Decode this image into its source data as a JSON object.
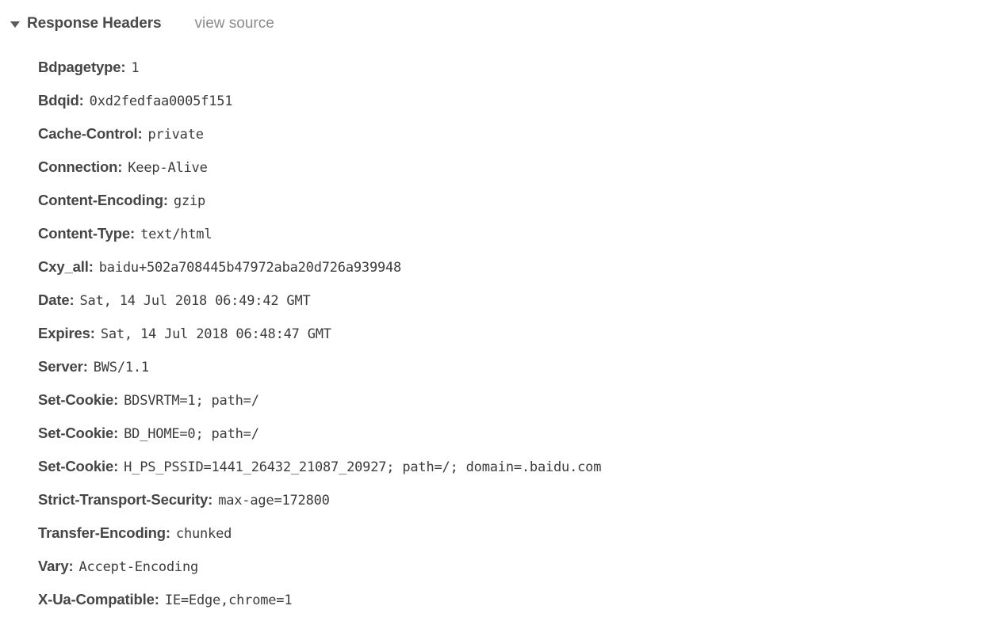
{
  "panel": {
    "title": "Response Headers",
    "view_source_label": "view source",
    "expanded": true,
    "disclosure_icon": "triangle-down-icon",
    "colors": {
      "background": "#ffffff",
      "header_name": "#454545",
      "header_value": "#3c3c3c",
      "section_title": "#4a4a4a",
      "link": "#8c8c8c"
    }
  },
  "headers": [
    {
      "name": "Bdpagetype:",
      "value": "1"
    },
    {
      "name": "Bdqid:",
      "value": "0xd2fedfaa0005f151"
    },
    {
      "name": "Cache-Control:",
      "value": "private"
    },
    {
      "name": "Connection:",
      "value": "Keep-Alive"
    },
    {
      "name": "Content-Encoding:",
      "value": "gzip"
    },
    {
      "name": "Content-Type:",
      "value": "text/html"
    },
    {
      "name": "Cxy_all:",
      "value": "baidu+502a708445b47972aba20d726a939948"
    },
    {
      "name": "Date:",
      "value": "Sat, 14 Jul 2018 06:49:42 GMT"
    },
    {
      "name": "Expires:",
      "value": "Sat, 14 Jul 2018 06:48:47 GMT"
    },
    {
      "name": "Server:",
      "value": "BWS/1.1"
    },
    {
      "name": "Set-Cookie:",
      "value": "BDSVRTM=1; path=/"
    },
    {
      "name": "Set-Cookie:",
      "value": "BD_HOME=0; path=/"
    },
    {
      "name": "Set-Cookie:",
      "value": "H_PS_PSSID=1441_26432_21087_20927; path=/; domain=.baidu.com"
    },
    {
      "name": "Strict-Transport-Security:",
      "value": "max-age=172800"
    },
    {
      "name": "Transfer-Encoding:",
      "value": "chunked"
    },
    {
      "name": "Vary:",
      "value": "Accept-Encoding"
    },
    {
      "name": "X-Ua-Compatible:",
      "value": "IE=Edge,chrome=1"
    }
  ]
}
